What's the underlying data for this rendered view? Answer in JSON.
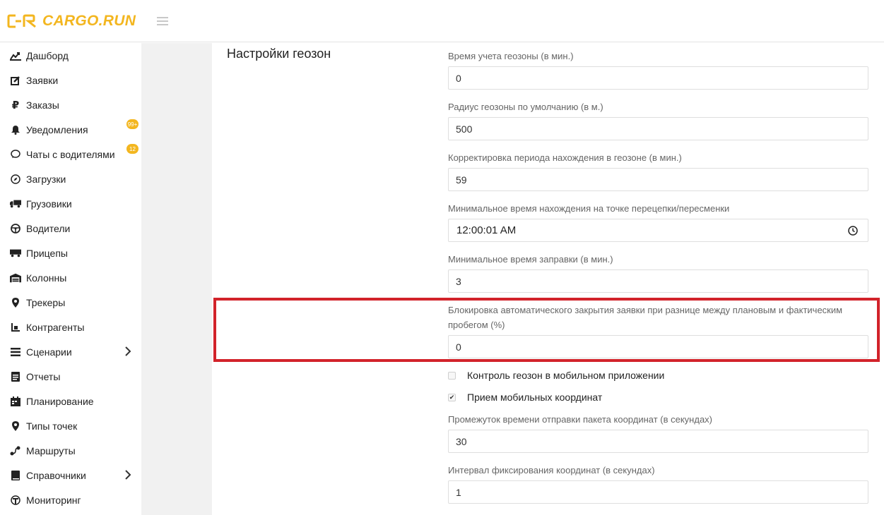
{
  "header": {
    "logo_text": "CARGO.RUN",
    "brand_color": "#f3b61f",
    "menu_icon": "hamburger-icon"
  },
  "sidebar": {
    "items": [
      {
        "label": "Дашборд",
        "icon": "dashboard-icon"
      },
      {
        "label": "Заявки",
        "icon": "edit-icon"
      },
      {
        "label": "Заказы",
        "icon": "ruble-icon"
      },
      {
        "label": "Уведомления",
        "icon": "bell-icon",
        "badge": "99+"
      },
      {
        "label": "Чаты с водителями",
        "icon": "chat-icon",
        "badge": "12"
      },
      {
        "label": "Загрузки",
        "icon": "compass-icon"
      },
      {
        "label": "Грузовики",
        "icon": "truck-icon"
      },
      {
        "label": "Водители",
        "icon": "steering-wheel-icon"
      },
      {
        "label": "Прицепы",
        "icon": "trailer-icon"
      },
      {
        "label": "Колонны",
        "icon": "warehouse-icon"
      },
      {
        "label": "Трекеры",
        "icon": "map-marker-icon"
      },
      {
        "label": "Контрагенты",
        "icon": "dolly-icon"
      },
      {
        "label": "Сценарии",
        "icon": "list-icon",
        "has_submenu": true
      },
      {
        "label": "Отчеты",
        "icon": "report-icon"
      },
      {
        "label": "Планирование",
        "icon": "calendar-icon"
      },
      {
        "label": "Типы точек",
        "icon": "map-marker-icon"
      },
      {
        "label": "Маршруты",
        "icon": "route-icon"
      },
      {
        "label": "Справочники",
        "icon": "book-icon",
        "has_submenu": true
      },
      {
        "label": "Мониторинг",
        "icon": "monitoring-icon"
      }
    ]
  },
  "main": {
    "section_title": "Настройки геозон",
    "fields": {
      "geozone_time": {
        "label": "Время учета геозоны (в мин.)",
        "value": "0"
      },
      "geozone_radius": {
        "label": "Радиус геозоны по умолчанию (в м.)",
        "value": "500"
      },
      "period_correction": {
        "label": "Корректировка периода нахождения в геозоне (в мин.)",
        "value": "59"
      },
      "min_time_point": {
        "label": "Минимальное время нахождения на точке перецепки/пересменки",
        "value": "12:00:01 AM"
      },
      "min_refuel_time": {
        "label": "Минимальное время заправки (в мин.)",
        "value": "3"
      },
      "auto_close_block": {
        "label": "Блокировка автоматического закрытия заявки при разнице между плановым и фактическим пробегом (%)",
        "value": "0"
      },
      "send_interval": {
        "label": "Промежуток времени отправки пакета координат (в секундах)",
        "value": "30"
      },
      "fix_interval": {
        "label": "Интервал фиксирования координат (в секундах)",
        "value": "1"
      }
    },
    "checkboxes": {
      "geozone_control": {
        "label": "Контроль геозон в мобильном приложении",
        "checked": false
      },
      "mobile_coords": {
        "label": "Прием мобильных координат",
        "checked": true
      }
    },
    "highlight_color": "#d2232a"
  }
}
